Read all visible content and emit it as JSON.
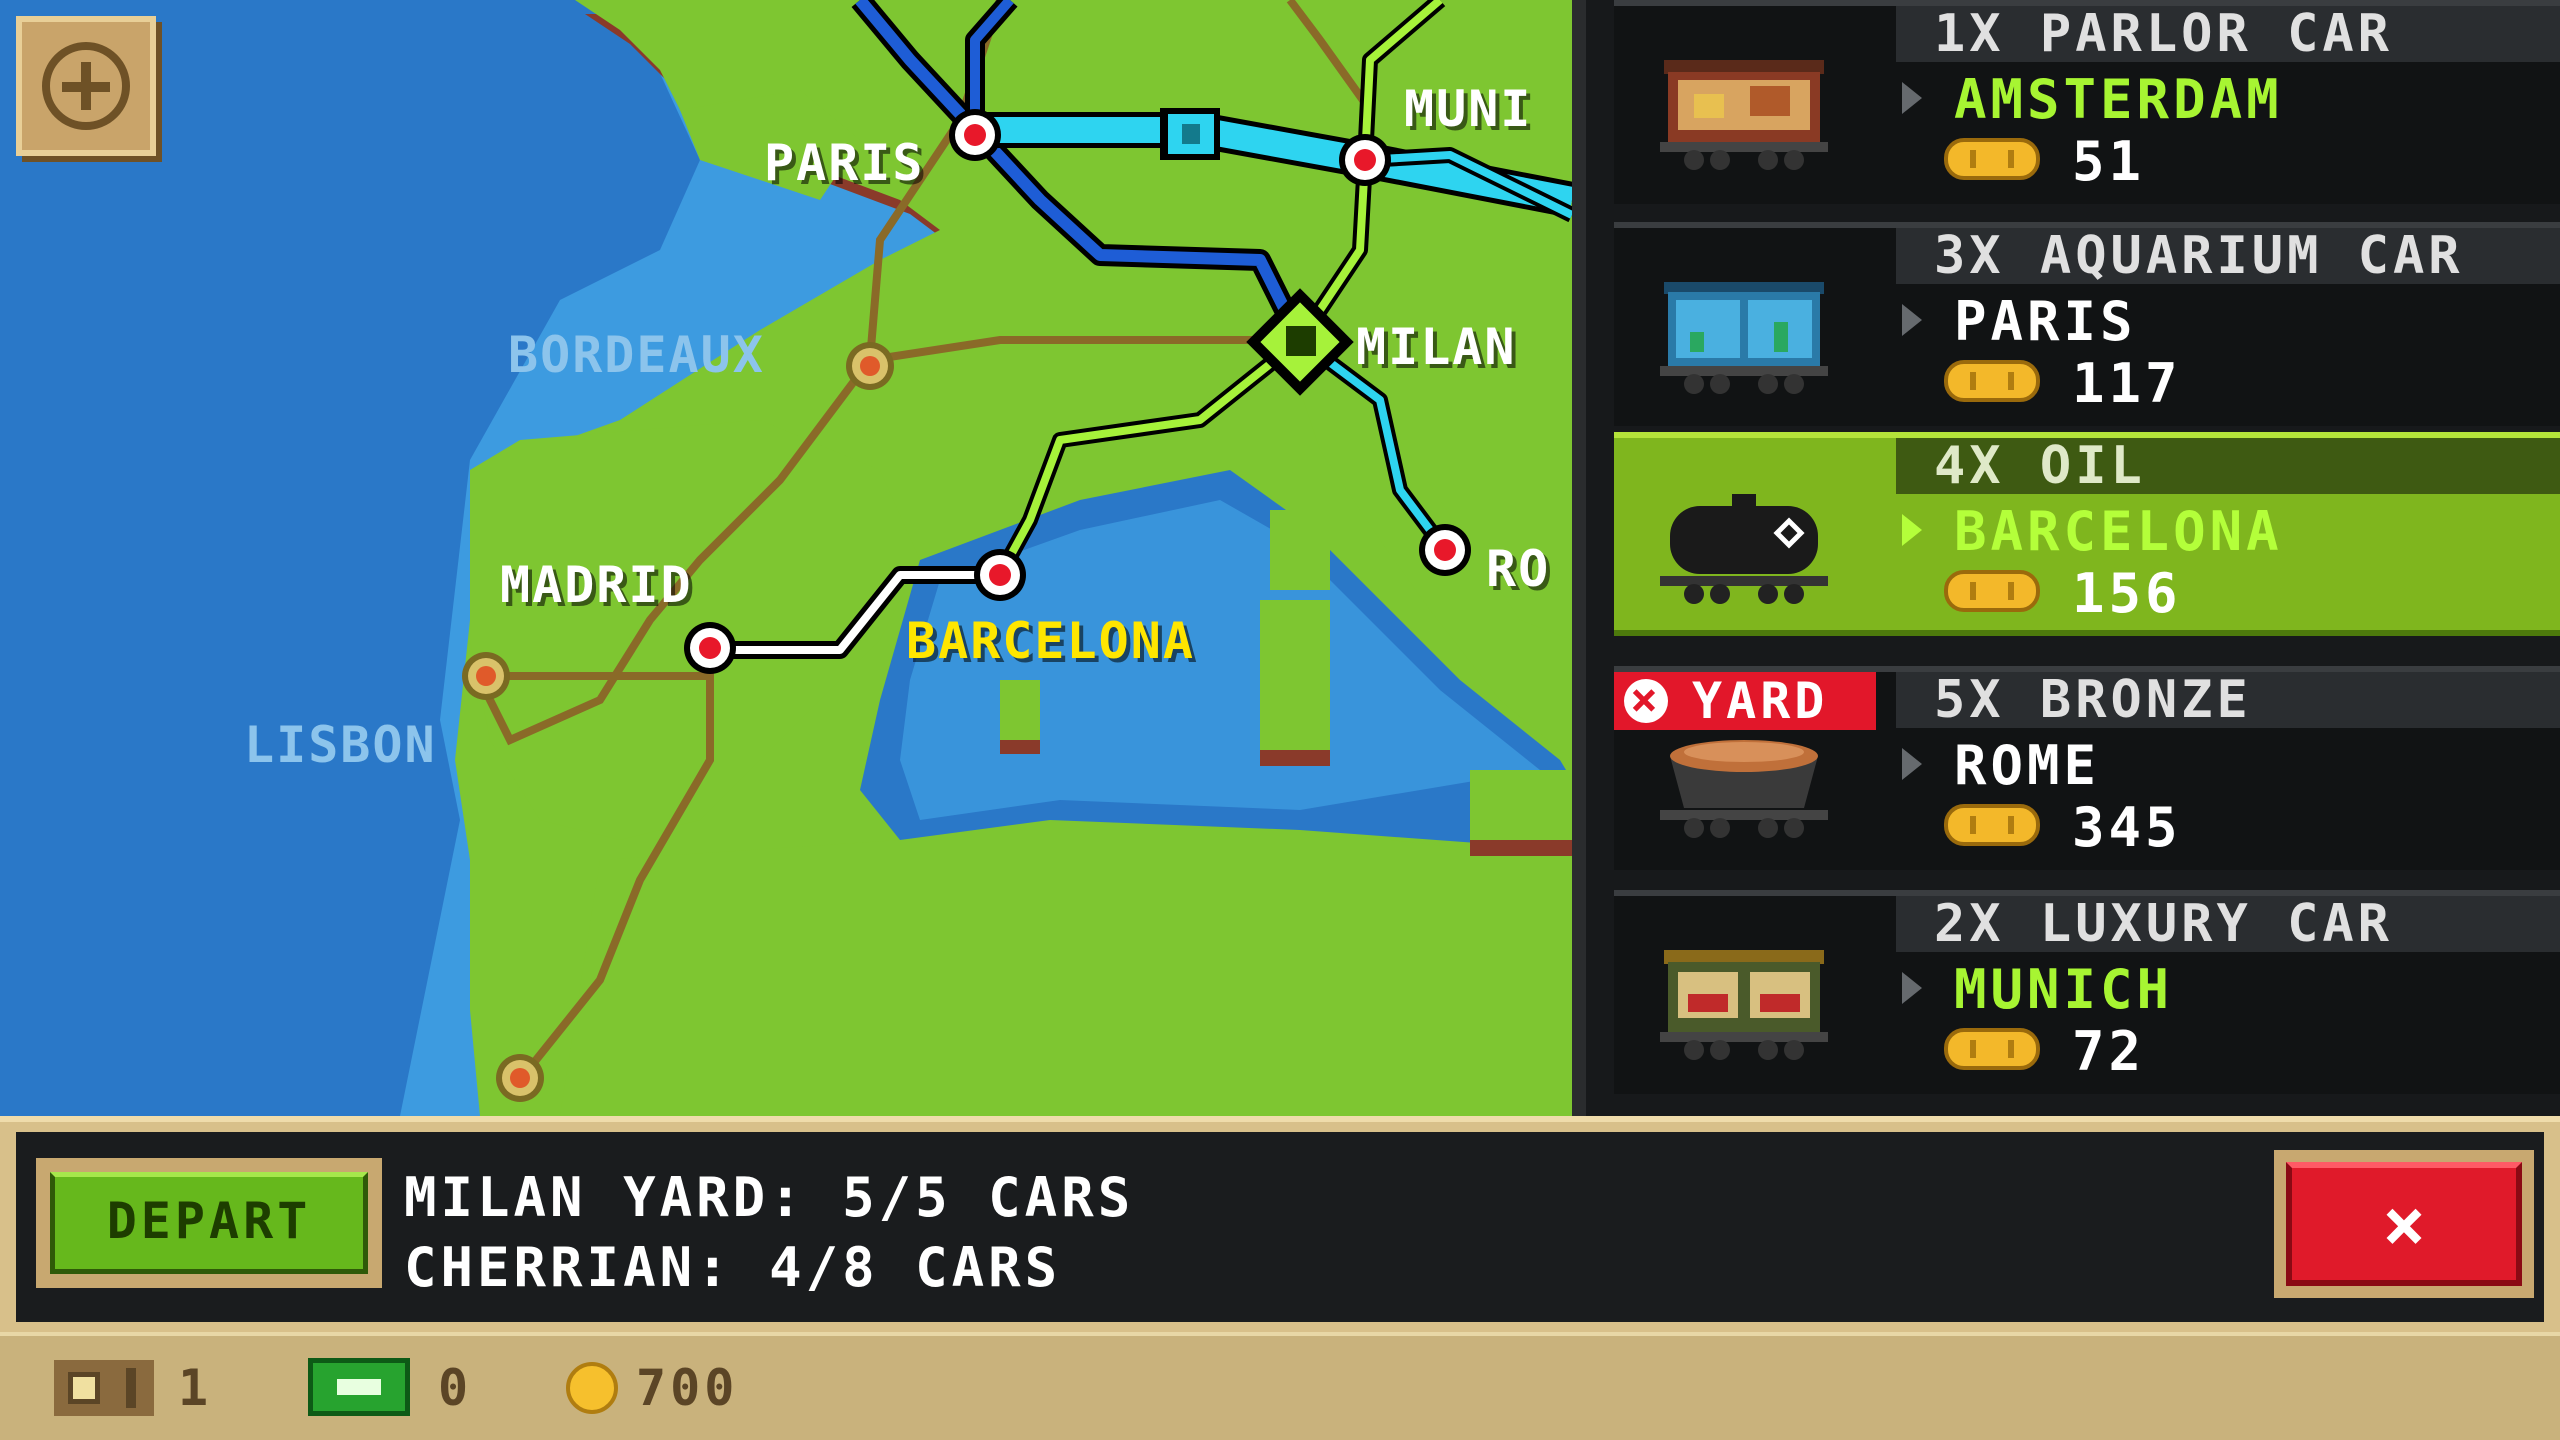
{
  "map": {
    "cities": [
      {
        "name": "PARIS",
        "style": "white"
      },
      {
        "name": "MUNI",
        "style": "white"
      },
      {
        "name": "BORDEAUX",
        "style": "faded"
      },
      {
        "name": "MILAN",
        "style": "white"
      },
      {
        "name": "MADRID",
        "style": "white"
      },
      {
        "name": "BARCELONA",
        "style": "yellow"
      },
      {
        "name": "RO",
        "style": "white"
      },
      {
        "name": "LISBON",
        "style": "faded"
      }
    ],
    "zoom_icon": "plus-icon"
  },
  "cargo": [
    {
      "qty": "1X PARLOR CAR",
      "dest": "AMSTERDAM",
      "dest_color": "#a7f532",
      "price": "51",
      "badge": ""
    },
    {
      "qty": "3X AQUARIUM CAR",
      "dest": "PARIS",
      "dest_color": "#ffffff",
      "price": "117",
      "badge": ""
    },
    {
      "qty": "4X OIL",
      "dest": "BARCELONA",
      "dest_color": "#b4ff3a",
      "price": "156",
      "badge": "",
      "selected": true
    },
    {
      "qty": "5X BRONZE",
      "dest": "ROME",
      "dest_color": "#ffffff",
      "price": "345",
      "badge": "YARD"
    },
    {
      "qty": "2X LUXURY CAR",
      "dest": "MUNICH",
      "dest_color": "#a7f532",
      "price": "72",
      "badge": ""
    }
  ],
  "train": {
    "depart_label": "DEPART",
    "yard_line": "MILAN YARD: 5/5 CARS",
    "train_line": "CHERRIAN: 4/8 CARS",
    "close_label": "×"
  },
  "status": {
    "crates": "1",
    "cash": "0",
    "coins": "700"
  },
  "colors": {
    "sea": "#2a78c8",
    "land": "#7ec631",
    "coast": "#8a3a2a",
    "route_blue": "#1e5dd6",
    "route_cyan": "#2ed4f0",
    "route_green": "#a6f23a",
    "route_white": "#ffffff"
  }
}
